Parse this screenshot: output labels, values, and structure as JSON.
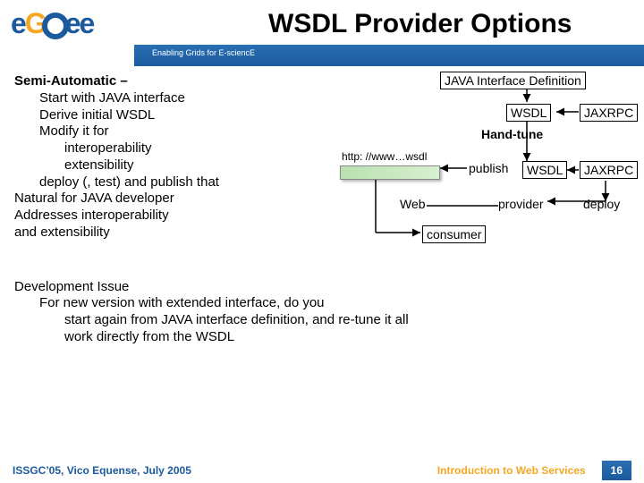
{
  "header": {
    "title": "WSDL Provider Options",
    "tagline": "Enabling Grids for E-sciencE",
    "logo": {
      "e": "e",
      "g": "G",
      "e2": "e",
      "e3": "e"
    }
  },
  "body": {
    "semi_heading": "Semi-Automatic –",
    "l1": "Start with JAVA interface",
    "l2": "Derive initial WSDL",
    "l3": "Modify it for",
    "l3a": "interoperability",
    "l3b": "extensibility",
    "l4": "deploy (, test) and publish that",
    "l5": "Natural for JAVA developer",
    "l6": "Addresses interoperability",
    "l7": "and extensibility",
    "dev_heading": "Development Issue",
    "dev1": "For new version with extended interface, do you",
    "dev2": "start again from JAVA interface definition, and re-tune it all",
    "dev3": "work directly from the WSDL"
  },
  "diagram": {
    "java_def": "JAVA Interface Definition",
    "wsdl1": "WSDL",
    "jaxrpc1": "JAXRPC",
    "hand_tune": "Hand-tune",
    "http": "http: //www…wsdl",
    "publish": "publish",
    "wsdl2": "WSDL",
    "jaxrpc2": "JAXRPC",
    "web": "Web",
    "provider": "provider",
    "deploy": "deploy",
    "consumer": "consumer"
  },
  "footer": {
    "left": "ISSGC’05, Vico Equense, July 2005",
    "right": "Introduction to Web Services",
    "page": "16"
  }
}
